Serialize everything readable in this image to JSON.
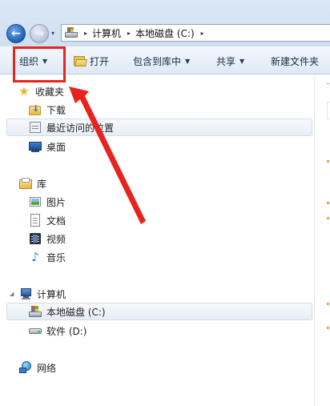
{
  "address_bar": {
    "crumbs": [
      "计算机",
      "本地磁盘 (C:)"
    ],
    "nav_dropdown_glyph": "▾",
    "separator_glyph": "▸"
  },
  "command_bar": {
    "organize": "组织",
    "open": "打开",
    "include_in_library": "包含到库中",
    "share": "共享",
    "new_folder": "新建文件夹",
    "dropdown_glyph": "▼"
  },
  "nav_pane": {
    "favorites": {
      "header": "收藏夹",
      "items": [
        "下载",
        "最近访问的位置",
        "桌面"
      ]
    },
    "libraries": {
      "header": "库",
      "items": [
        "图片",
        "文档",
        "视频",
        "音乐"
      ]
    },
    "computer": {
      "header": "计算机",
      "items": [
        "本地磁盘 (C:)",
        "软件 (D:)"
      ]
    },
    "network": {
      "header": "网络"
    }
  },
  "icons": {
    "back": "back-arrow-icon",
    "forward": "forward-arrow-icon",
    "drive": "windows-drive-icon",
    "favorites": "star-icon",
    "downloads": "download-folder-icon",
    "recent": "recent-places-icon",
    "desktop": "desktop-icon",
    "libraries": "library-icon",
    "pictures": "pictures-icon",
    "documents": "document-icon",
    "videos": "video-icon",
    "music": "music-note-icon",
    "computer": "computer-icon",
    "network": "network-icon"
  },
  "colors": {
    "annotation": "#e8231f",
    "selection": "#e7edf5",
    "command_bar": "#dfe9f5"
  }
}
